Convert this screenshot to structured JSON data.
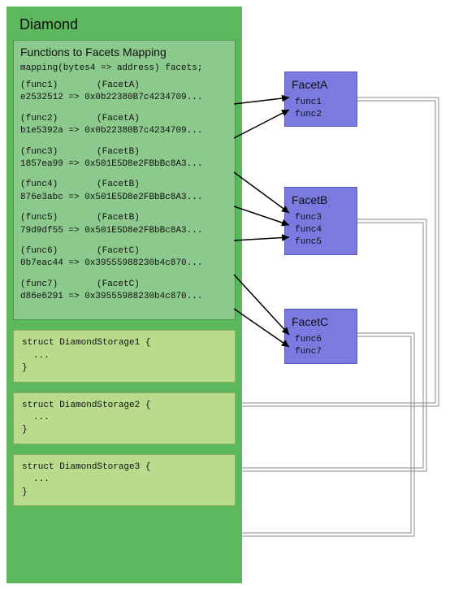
{
  "diamond": {
    "title": "Diamond",
    "mapping": {
      "title": "Functions to Facets Mapping",
      "declaration": "mapping(bytes4 => address) facets;",
      "entries": [
        {
          "funcLabel": "(func1)",
          "facetLabel": "(FacetA)",
          "selector": "e2532512",
          "arrow": "=>",
          "address": "0x0b22380B7c4234709..."
        },
        {
          "funcLabel": "(func2)",
          "facetLabel": "(FacetA)",
          "selector": "b1e5392a",
          "arrow": "=>",
          "address": "0x0b22380B7c4234709..."
        },
        {
          "funcLabel": "(func3)",
          "facetLabel": "(FacetB)",
          "selector": "1857ea99",
          "arrow": "=>",
          "address": "0x501E5D8e2FBbBc8A3..."
        },
        {
          "funcLabel": "(func4)",
          "facetLabel": "(FacetB)",
          "selector": "876e3abc",
          "arrow": "=>",
          "address": "0x501E5D8e2FBbBc8A3..."
        },
        {
          "funcLabel": "(func5)",
          "facetLabel": "(FacetB)",
          "selector": "79d9df55",
          "arrow": "=>",
          "address": "0x501E5D8e2FBbBc8A3..."
        },
        {
          "funcLabel": "(func6)",
          "facetLabel": "(FacetC)",
          "selector": "0b7eac44",
          "arrow": "=>",
          "address": "0x39555988230b4c870..."
        },
        {
          "funcLabel": "(func7)",
          "facetLabel": "(FacetC)",
          "selector": "d86e6291",
          "arrow": "=>",
          "address": "0x39555988230b4c870..."
        }
      ]
    },
    "storages": [
      {
        "decl": "struct DiamondStorage1 {",
        "body": "...",
        "close": "}"
      },
      {
        "decl": "struct DiamondStorage2 {",
        "body": "...",
        "close": "}"
      },
      {
        "decl": "struct DiamondStorage3 {",
        "body": "...",
        "close": "}"
      }
    ]
  },
  "facets": [
    {
      "name": "FacetA",
      "funcs": [
        "func1",
        "func2"
      ]
    },
    {
      "name": "FacetB",
      "funcs": [
        "func3",
        "func4",
        "func5"
      ]
    },
    {
      "name": "FacetC",
      "funcs": [
        "func6",
        "func7"
      ]
    }
  ]
}
